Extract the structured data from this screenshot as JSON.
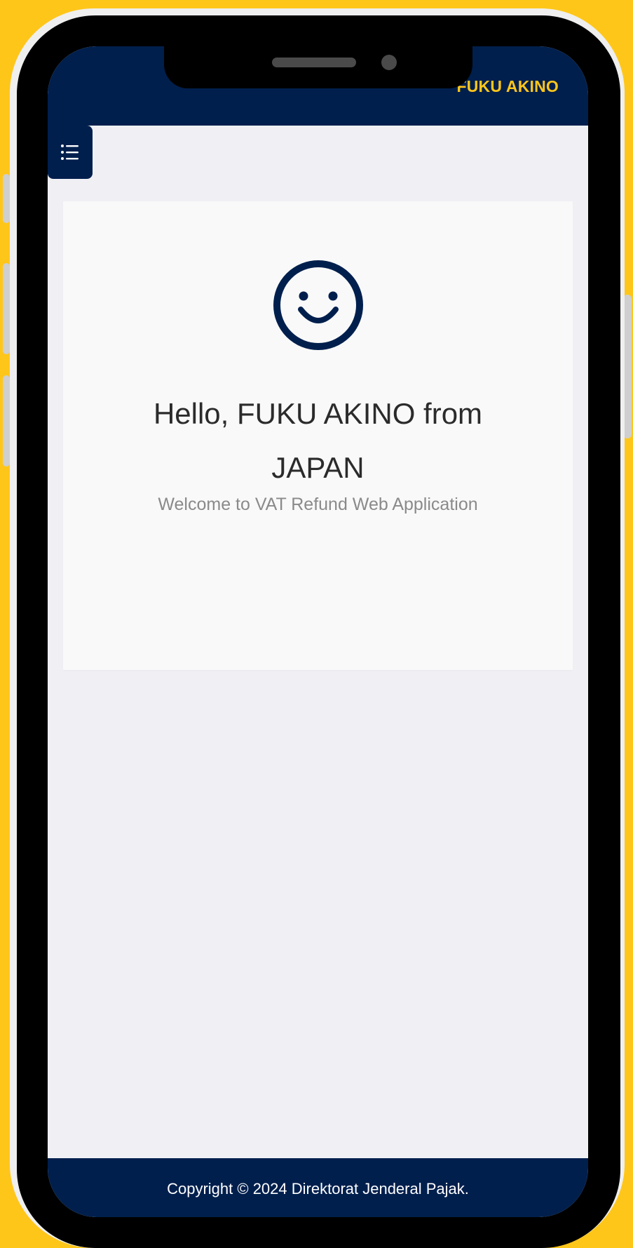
{
  "header": {
    "user_name": "FUKU AKINO"
  },
  "menu": {
    "icon": "list-icon"
  },
  "welcome": {
    "icon": "smiley-icon",
    "greeting": "Hello, FUKU AKINO from JAPAN",
    "subtitle": "Welcome to VAT Refund Web Application"
  },
  "footer": {
    "copyright": "Copyright © 2024 Direktorat Jenderal Pajak."
  },
  "colors": {
    "background_outer": "#FFC61A",
    "navy": "#001F4D",
    "accent_yellow": "#FFC61A",
    "screen_bg": "#F0F0F4",
    "card_bg": "#F9F9F9"
  }
}
